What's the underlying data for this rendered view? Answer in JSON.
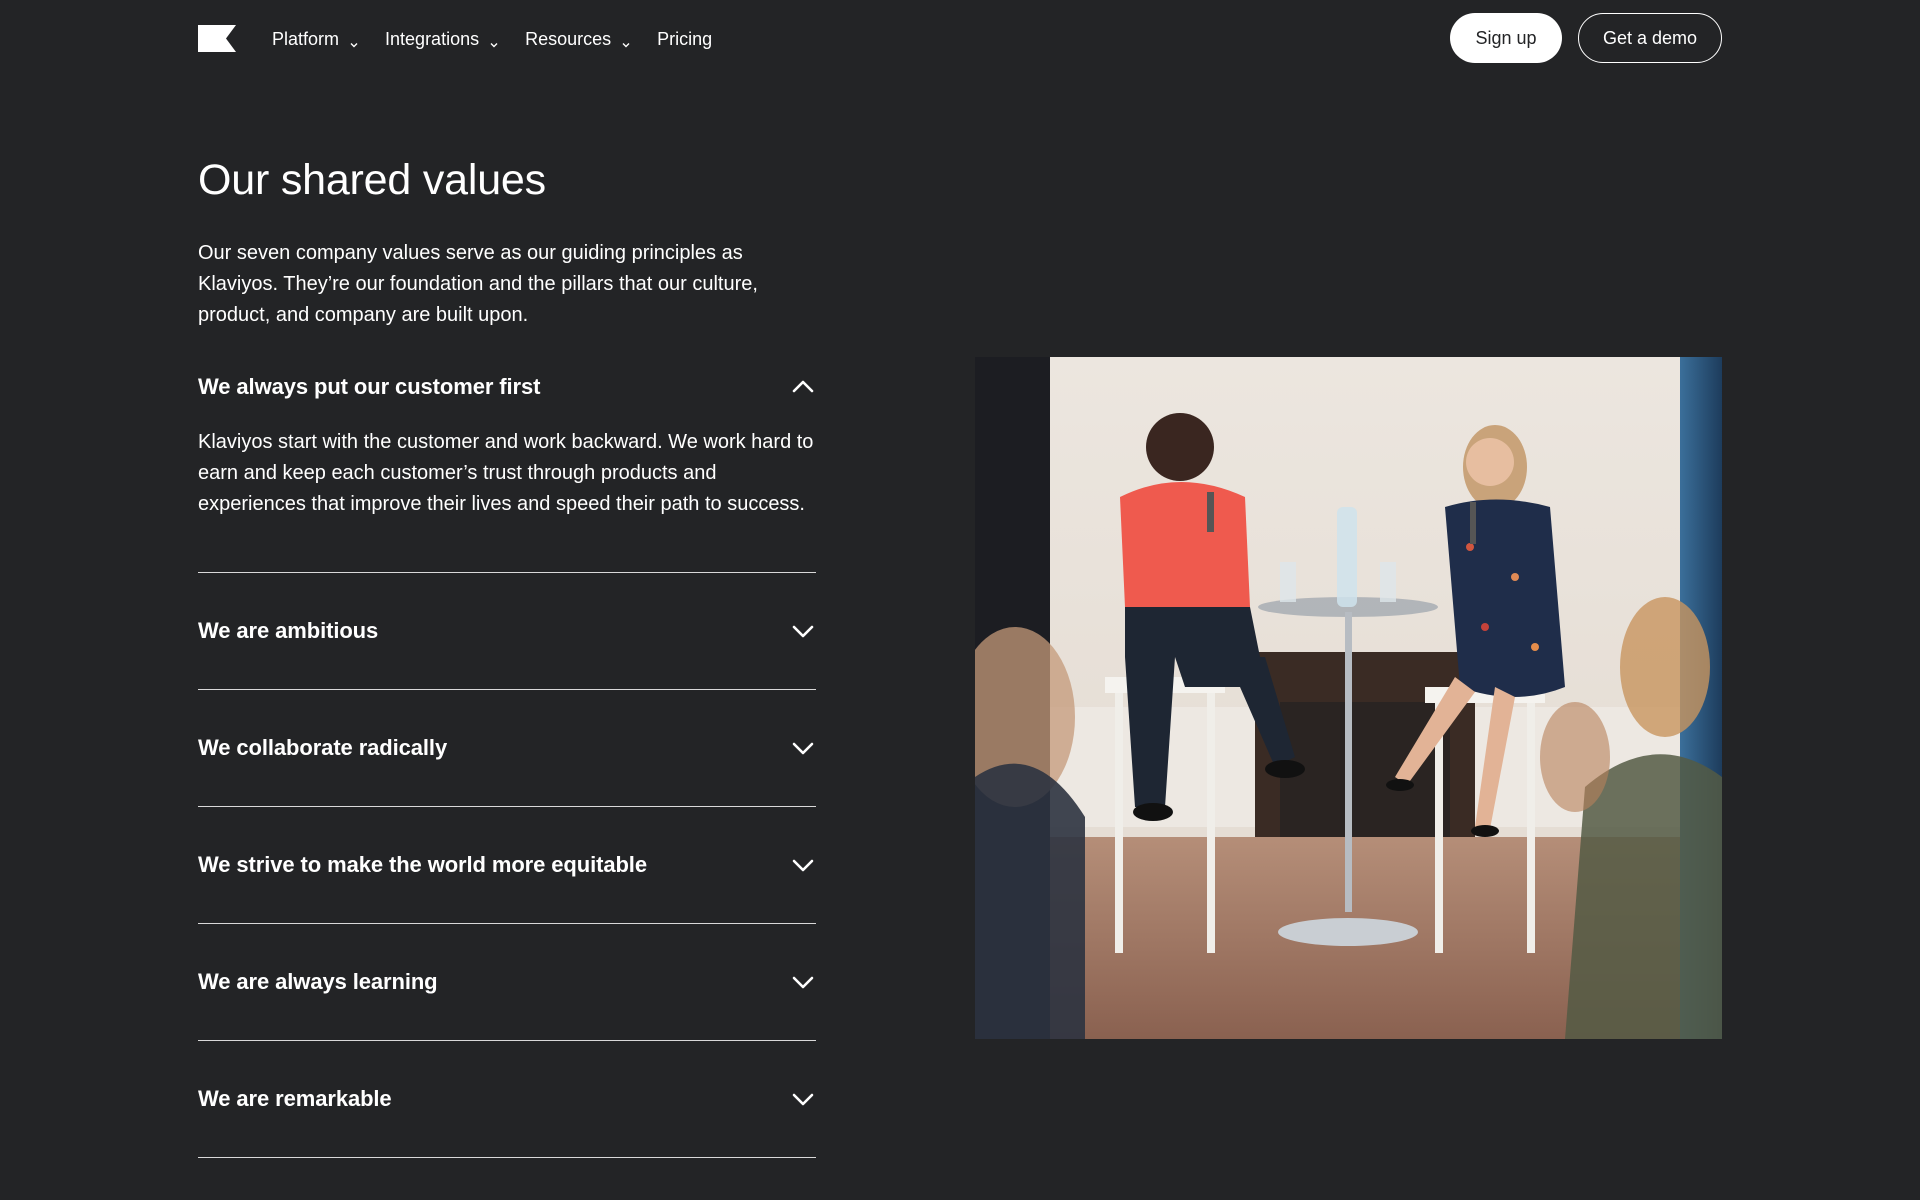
{
  "nav": {
    "logo_alt": "Klaviyo logo",
    "links": [
      {
        "label": "Platform",
        "has_dropdown": true
      },
      {
        "label": "Integrations",
        "has_dropdown": true
      },
      {
        "label": "Resources",
        "has_dropdown": true
      },
      {
        "label": "Pricing",
        "has_dropdown": false
      }
    ],
    "signup_label": "Sign up",
    "demo_label": "Get a demo"
  },
  "values_section": {
    "heading": "Our shared values",
    "intro": "Our seven company values serve as our guiding principles as Klaviyos. They’re our foundation and the pillars that our culture, product, and company are built upon.",
    "items": [
      {
        "title": "We always put our customer first",
        "expanded": true,
        "body": "Klaviyos start with the customer and work backward. We work hard to earn and keep each customer’s trust through products and experiences that improve their lives and speed their path to success."
      },
      {
        "title": "We are ambitious",
        "expanded": false
      },
      {
        "title": "We collaborate radically",
        "expanded": false
      },
      {
        "title": "We strive to make the world more equitable",
        "expanded": false
      },
      {
        "title": "We are always learning",
        "expanded": false
      },
      {
        "title": "We are remarkable",
        "expanded": false
      }
    ]
  },
  "photo": {
    "description_icon": "panel-discussion-photo"
  },
  "colors": {
    "background": "#232426",
    "text": "#ffffff",
    "divider": "#d9d9d9"
  }
}
